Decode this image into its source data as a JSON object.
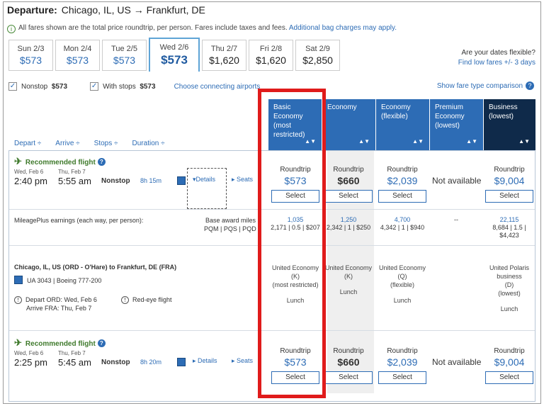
{
  "header": {
    "label": "Departure:",
    "route": "Chicago, IL, US → Frankfurt, DE"
  },
  "notice": {
    "text": "All fares shown are the total price roundtrip, per person. Fares include taxes and fees.",
    "link": "Additional bag charges may apply."
  },
  "dates": [
    {
      "day": "Sun 2/3",
      "price": "$573"
    },
    {
      "day": "Mon 2/4",
      "price": "$573"
    },
    {
      "day": "Tue 2/5",
      "price": "$573"
    },
    {
      "day": "Wed 2/6",
      "price": "$573"
    },
    {
      "day": "Thu 2/7",
      "price": "$1,620"
    },
    {
      "day": "Fri 2/8",
      "price": "$1,620"
    },
    {
      "day": "Sat 2/9",
      "price": "$2,850"
    }
  ],
  "flexible": {
    "question": "Are your dates flexible?",
    "link": "Find low fares +/- 3 days"
  },
  "filters": {
    "nonstop": "Nonstop",
    "nonstop_price": "$573",
    "stops": "With stops",
    "stops_price": "$573",
    "connect": "Choose connecting airports"
  },
  "compare": "Show fare type comparison",
  "sorts": [
    "Depart ÷",
    "Arrive ÷",
    "Stops ÷",
    "Duration ÷"
  ],
  "columns": [
    {
      "title": "Basic Economy (most restricted)"
    },
    {
      "title": "Economy"
    },
    {
      "title": "Economy (flexible)"
    },
    {
      "title": "Premium Economy (lowest)"
    },
    {
      "title": "Business (lowest)"
    }
  ],
  "flight1": {
    "rec": "Recommended flight",
    "dep_date": "Wed, Feb 6",
    "arr_date": "Thu, Feb 7",
    "dep_time": "2:40 pm",
    "arr_time": "5:55 am",
    "stops": "Nonstop",
    "duration": "8h 15m",
    "details": "▾Details",
    "seats": "▸ Seats",
    "fares": [
      {
        "label": "Roundtrip",
        "price": "$573",
        "select": "Select"
      },
      {
        "label": "Roundtrip",
        "price": "$660",
        "select": "Select"
      },
      {
        "label": "Roundtrip",
        "price": "$2,039",
        "select": "Select"
      },
      {
        "na": "Not available"
      },
      {
        "label": "Roundtrip",
        "price": "$9,004",
        "select": "Select"
      }
    ]
  },
  "miles": {
    "label": "MileagePlus earnings (each way, per person):",
    "base": "Base award miles",
    "pqm": "PQM | PQS | PQD",
    "values": [
      {
        "a": "1,035",
        "b": "2,171 | 0.5 | $207"
      },
      {
        "a": "1,250",
        "b": "2,342 | 1 | $250"
      },
      {
        "a": "4,700",
        "b": "4,342 | 1 | $940"
      },
      {
        "a": "--",
        "b": ""
      },
      {
        "a": "22,115",
        "b": "8,684 | 1.5 |",
        "c": "$4,423"
      }
    ]
  },
  "details": {
    "route": "Chicago, IL, US (ORD - O'Hare) to Frankfurt, DE (FRA)",
    "flight": "UA 3043 | Boeing 777-200",
    "depart": "Depart ORD: Wed, Feb 6",
    "arrive": "Arrive FRA: Thu, Feb 7",
    "redeye": "Red-eye flight",
    "cabins": [
      {
        "l1": "United Economy",
        "l2": "(K)",
        "l3": "(most restricted)",
        "meal": "Lunch"
      },
      {
        "l1": "United Economy",
        "l2": "(K)",
        "l3": "",
        "meal": "Lunch"
      },
      {
        "l1": "United Economy",
        "l2": "(Q)",
        "l3": "(flexible)",
        "meal": "Lunch"
      },
      {
        "l1": "",
        "l2": "",
        "l3": "",
        "meal": ""
      },
      {
        "l1": "United Polaris",
        "l2": "business",
        "l3": "(D)",
        "l4": "(lowest)",
        "meal": "Lunch"
      }
    ]
  },
  "flight2": {
    "rec": "Recommended flight",
    "dep_date": "Wed, Feb 6",
    "arr_date": "Thu, Feb 7",
    "dep_time": "2:25 pm",
    "arr_time": "5:45 am",
    "stops": "Nonstop",
    "duration": "8h 20m",
    "details": "▸ Details",
    "seats": "▸ Seats",
    "fares": [
      {
        "label": "Roundtrip",
        "price": "$573",
        "select": "Select"
      },
      {
        "label": "Roundtrip",
        "price": "$660",
        "select": "Select"
      },
      {
        "label": "Roundtrip",
        "price": "$2,039",
        "select": "Select"
      },
      {
        "na": "Not available"
      },
      {
        "label": "Roundtrip",
        "price": "$9,004",
        "select": "Select"
      }
    ]
  },
  "colors": {
    "accent": "#2d6cb5",
    "business": "#0f2a4a",
    "highlight": "#e01b1b"
  }
}
